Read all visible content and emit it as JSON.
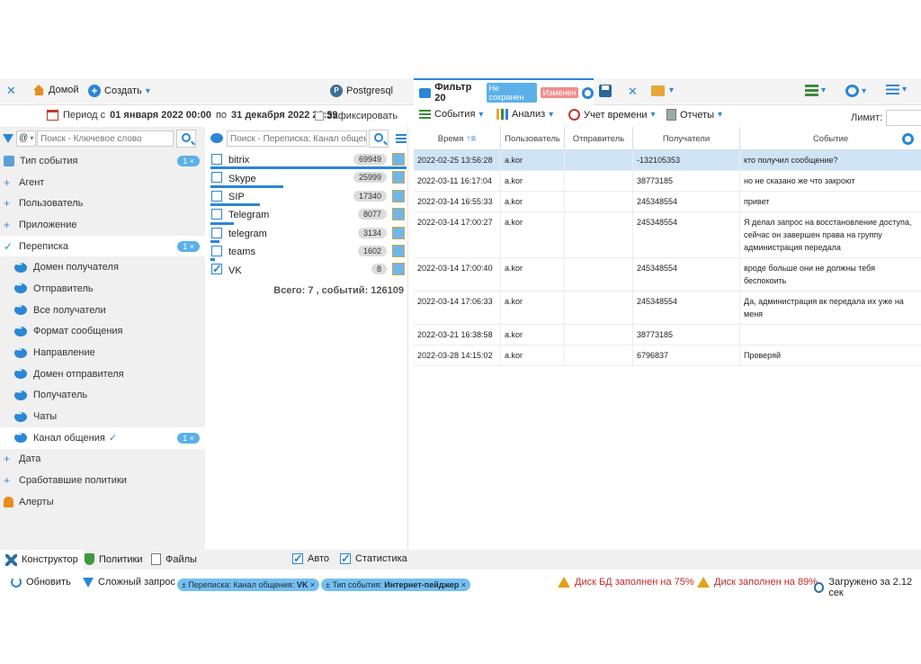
{
  "header": {
    "home_label": "Домой",
    "create_label": "Создать",
    "db_label": "Postgresql",
    "filter_tab": {
      "title": "Фильтр 20",
      "badge_unsaved": "Не сохранен",
      "badge_changed": "Изменен"
    }
  },
  "period": {
    "prefix": "Период с",
    "from": "01 января 2022 00:00",
    "mid": "по",
    "to": "31 декабря 2022 23:59",
    "fix_label": "Зафиксировать"
  },
  "toolbar": {
    "events": "События",
    "analysis": "Анализ",
    "time": "Учет времени",
    "reports": "Отчеты",
    "limit_label": "Лимит:"
  },
  "left": {
    "at_value": "@",
    "search_placeholder": "Поиск - Ключевое слово",
    "items": [
      {
        "label": "Тип события",
        "pill": "1 ×"
      },
      {
        "label": "Агент"
      },
      {
        "label": "Пользователь"
      },
      {
        "label": "Приложение"
      },
      {
        "label": "Переписка",
        "pill": "1 ×"
      },
      {
        "label": "Домен получателя"
      },
      {
        "label": "Отправитель"
      },
      {
        "label": "Все получатели"
      },
      {
        "label": "Формат сообщения"
      },
      {
        "label": "Направление"
      },
      {
        "label": "Домен отправителя"
      },
      {
        "label": "Получатель"
      },
      {
        "label": "Чаты"
      },
      {
        "label": "Канал общения",
        "pill": "1 ×"
      },
      {
        "label": "Дата"
      },
      {
        "label": "Сработавшие политики"
      },
      {
        "label": "Алерты"
      }
    ]
  },
  "mid": {
    "search_placeholder": "Поиск - Переписка: Канал общения",
    "values": [
      {
        "label": "bitrix",
        "count": "69949",
        "fraction": 1.0
      },
      {
        "label": "Skype",
        "count": "25999",
        "fraction": 0.37
      },
      {
        "label": "SIP",
        "count": "17340",
        "fraction": 0.25
      },
      {
        "label": "Telegram",
        "count": "8077",
        "fraction": 0.12
      },
      {
        "label": "telegram",
        "count": "3134",
        "fraction": 0.045
      },
      {
        "label": "teams",
        "count": "1602",
        "fraction": 0.023
      },
      {
        "label": "VK",
        "count": "8",
        "fraction": 0.0
      }
    ],
    "total": "Всего: 7 , событий: 126109"
  },
  "table": {
    "headers": [
      "Время",
      "Пользователь",
      "Отправитель",
      "Получатели",
      "Событие"
    ],
    "rows": [
      [
        "2022-02-25 13:56:28",
        "a.kor",
        "",
        "-132105353",
        "кто получил сообщение?"
      ],
      [
        "2022-03-11 16:17:04",
        "a.kor",
        "",
        "38773185",
        "но не сказано же что закроют"
      ],
      [
        "2022-03-14 16:55:33",
        "a.kor",
        "",
        "245348554",
        "привет"
      ],
      [
        "2022-03-14 17:00:27",
        "a.kor",
        "",
        "245348554",
        "Я делал запрос на восстановление доступа, сейчас он завершен права на группу администрация передала"
      ],
      [
        "2022-03-14 17:00:40",
        "a.kor",
        "",
        "245348554",
        "вроде больше они не должны тебя беспокоить"
      ],
      [
        "2022-03-14 17:06:33",
        "a.kor",
        "",
        "245348554",
        "Да, администрация вк передала их уже на меня"
      ],
      [
        "2022-03-21 16:38:58",
        "a.kor",
        "",
        "38773185",
        ""
      ],
      [
        "2022-03-28 14:15:02",
        "a.kor",
        "",
        "6796837",
        "Проверяй"
      ]
    ]
  },
  "bottom_tabs": {
    "constructor": "Конструктор",
    "policies": "Политики",
    "files": "Файлы",
    "auto": "Авто",
    "stats": "Статистика"
  },
  "status": {
    "refresh": "Обновить",
    "complex": "Сложный запрос",
    "chip1_prefix": "± Переписка: Канал общения:",
    "chip1_value": "VK",
    "chip2_prefix": "± Тип события:",
    "chip2_value": "Интернет-пейджер",
    "chip_close": "×",
    "disk_db": "Диск БД заполнен на 75%",
    "disk": "Диск заполнен на 89%",
    "loaded": "Загружено за 2.12 сек"
  }
}
